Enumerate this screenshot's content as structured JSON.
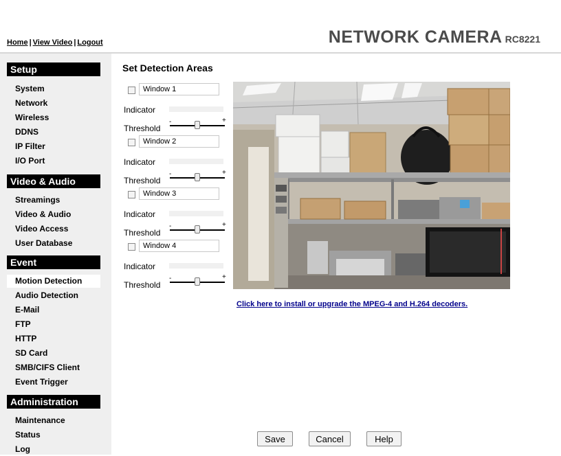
{
  "header": {
    "links": [
      "Home",
      "View Video",
      "Logout"
    ],
    "separator": "|",
    "brand": "NETWORK CAMERA",
    "model": "RC8221"
  },
  "sidebar": {
    "sections": [
      {
        "title": "Setup",
        "items": [
          "System",
          "Network",
          "Wireless",
          "DDNS",
          "IP Filter",
          "I/O Port"
        ]
      },
      {
        "title": "Video & Audio",
        "items": [
          "Streamings",
          "Video & Audio",
          "Video Access",
          "User Database"
        ]
      },
      {
        "title": "Event",
        "items": [
          "Motion Detection",
          "Audio Detection",
          "E-Mail",
          "FTP",
          "HTTP",
          "SD Card",
          "SMB/CIFS Client",
          "Event Trigger"
        ]
      },
      {
        "title": "Administration",
        "items": [
          "Maintenance",
          "Status",
          "Log"
        ]
      }
    ],
    "active_item": "Motion Detection"
  },
  "main": {
    "title": "Set Detection Areas",
    "windows": [
      {
        "name": "Window 1",
        "checked": false,
        "indicator_label": "Indicator",
        "threshold_label": "Threshold",
        "threshold_level": 0.5
      },
      {
        "name": "Window 2",
        "checked": false,
        "indicator_label": "Indicator",
        "threshold_label": "Threshold",
        "threshold_level": 0.5
      },
      {
        "name": "Window 3",
        "checked": false,
        "indicator_label": "Indicator",
        "threshold_label": "Threshold",
        "threshold_level": 0.5
      },
      {
        "name": "Window 4",
        "checked": false,
        "indicator_label": "Indicator",
        "threshold_label": "Threshold",
        "threshold_level": 0.5
      }
    ],
    "slider_min_symbol": "-",
    "slider_max_symbol": "+",
    "install_link": "Click here to install or upgrade the MPEG-4 and H.264 decoders."
  },
  "buttons": {
    "save": "Save",
    "cancel": "Cancel",
    "help": "Help"
  }
}
